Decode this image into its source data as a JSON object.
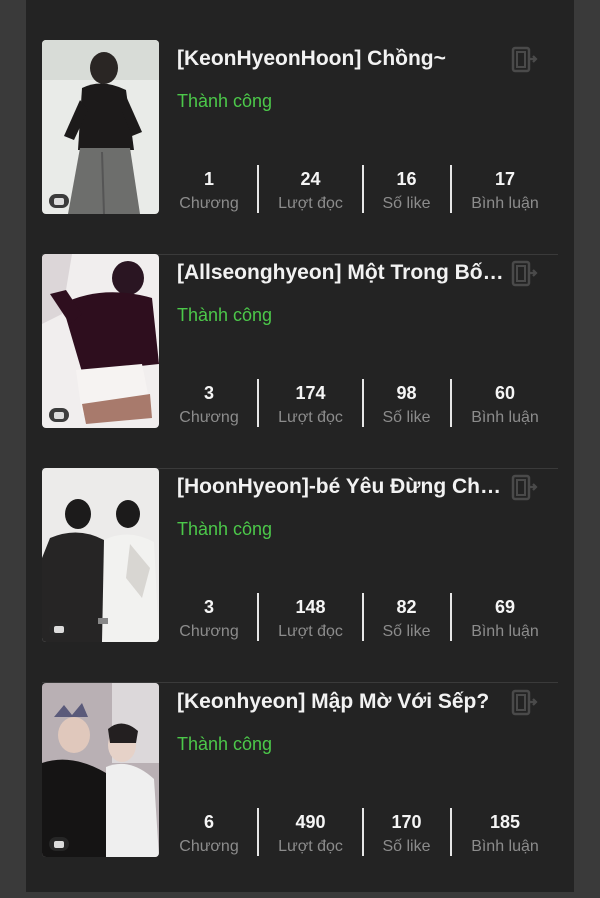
{
  "stories": [
    {
      "title": "[KeonHyeonHoon] Chồng~",
      "status": "Thành công",
      "stats": [
        {
          "value": "1",
          "label": "Chương"
        },
        {
          "value": "24",
          "label": "Lượt đọc"
        },
        {
          "value": "16",
          "label": "Số like"
        },
        {
          "value": "17",
          "label": "Bình luận"
        }
      ]
    },
    {
      "title": "[Allseonghyeon] Một Trong Bốn ...",
      "status": "Thành công",
      "stats": [
        {
          "value": "3",
          "label": "Chương"
        },
        {
          "value": "174",
          "label": "Lượt đọc"
        },
        {
          "value": "98",
          "label": "Số like"
        },
        {
          "value": "60",
          "label": "Bình luận"
        }
      ]
    },
    {
      "title": "[HoonHyeon]-bé Yêu Đừng Chạy~",
      "status": "Thành công",
      "stats": [
        {
          "value": "3",
          "label": "Chương"
        },
        {
          "value": "148",
          "label": "Lượt đọc"
        },
        {
          "value": "82",
          "label": "Số like"
        },
        {
          "value": "69",
          "label": "Bình luận"
        }
      ]
    },
    {
      "title": "[Keonhyeon] Mập Mờ Với Sếp?",
      "status": "Thành công",
      "stats": [
        {
          "value": "6",
          "label": "Chương"
        },
        {
          "value": "490",
          "label": "Lượt đọc"
        },
        {
          "value": "170",
          "label": "Số like"
        },
        {
          "value": "185",
          "label": "Bình luận"
        }
      ]
    }
  ],
  "colors": {
    "status": "#4cc84a",
    "panel": "#232323",
    "background": "#3a3a3a"
  },
  "icons": {
    "action": "export-icon",
    "cover_badge": "comment-icon"
  }
}
